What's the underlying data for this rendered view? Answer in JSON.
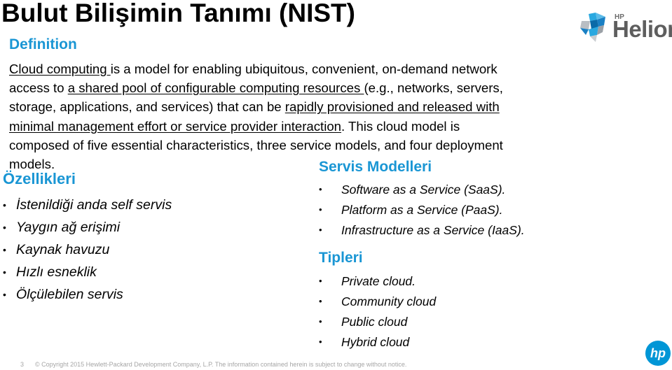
{
  "slide": {
    "title": "Bulut Bilişimin Tanımı (NIST)",
    "page_number": "3",
    "copyright": "© Copyright 2015 Hewlett-Packard Development Company, L.P.  The information contained herein is subject to change without notice."
  },
  "definition": {
    "heading": "Definition",
    "lines": [
      [
        {
          "text": "Cloud computing ",
          "underline": true
        },
        {
          "text": "is a model for enabling ubiquitous, convenient, on-demand network",
          "underline": false
        }
      ],
      [
        {
          "text": "access to ",
          "underline": false
        },
        {
          "text": "a shared pool of configurable computing resources ",
          "underline": true
        },
        {
          "text": "(e.g., networks, servers,",
          "underline": false
        }
      ],
      [
        {
          "text": "storage, applications, and services) that can be ",
          "underline": false
        },
        {
          "text": "rapidly provisioned and released with",
          "underline": true
        }
      ],
      [
        {
          "text": "minimal management effort or service provider interaction",
          "underline": true
        },
        {
          "text": ". This cloud model is",
          "underline": false
        }
      ],
      [
        {
          "text": "composed of five essential characteristics, three service models, and four deployment",
          "underline": false
        }
      ],
      [
        {
          "text": "models.",
          "underline": false
        }
      ]
    ]
  },
  "features": {
    "heading": "Özellikleri",
    "items": [
      "İstenildiği anda self servis",
      "Yaygın ağ erişimi",
      "Kaynak havuzu",
      "Hızlı esneklik",
      "Ölçülebilen servis"
    ]
  },
  "service_models": {
    "heading": "Servis Modelleri",
    "items": [
      "Software as a Service (SaaS).",
      "Platform as a Service (PaaS).",
      "Infrastructure as a Service (IaaS)."
    ]
  },
  "types": {
    "heading": "Tipleri",
    "items": [
      "Private cloud.",
      "Community cloud",
      "Public cloud",
      "Hybrid cloud"
    ]
  },
  "logos": {
    "helion_small": "HP",
    "helion_word": "Helion",
    "hp_mark": "hp"
  },
  "bullet_glyph": "•",
  "colors": {
    "accent": "#1a96d4",
    "text": "#000000",
    "footer": "#a6a6a6",
    "helion_gray": "#5e5e5e",
    "hp_blue": "#0096d6"
  }
}
